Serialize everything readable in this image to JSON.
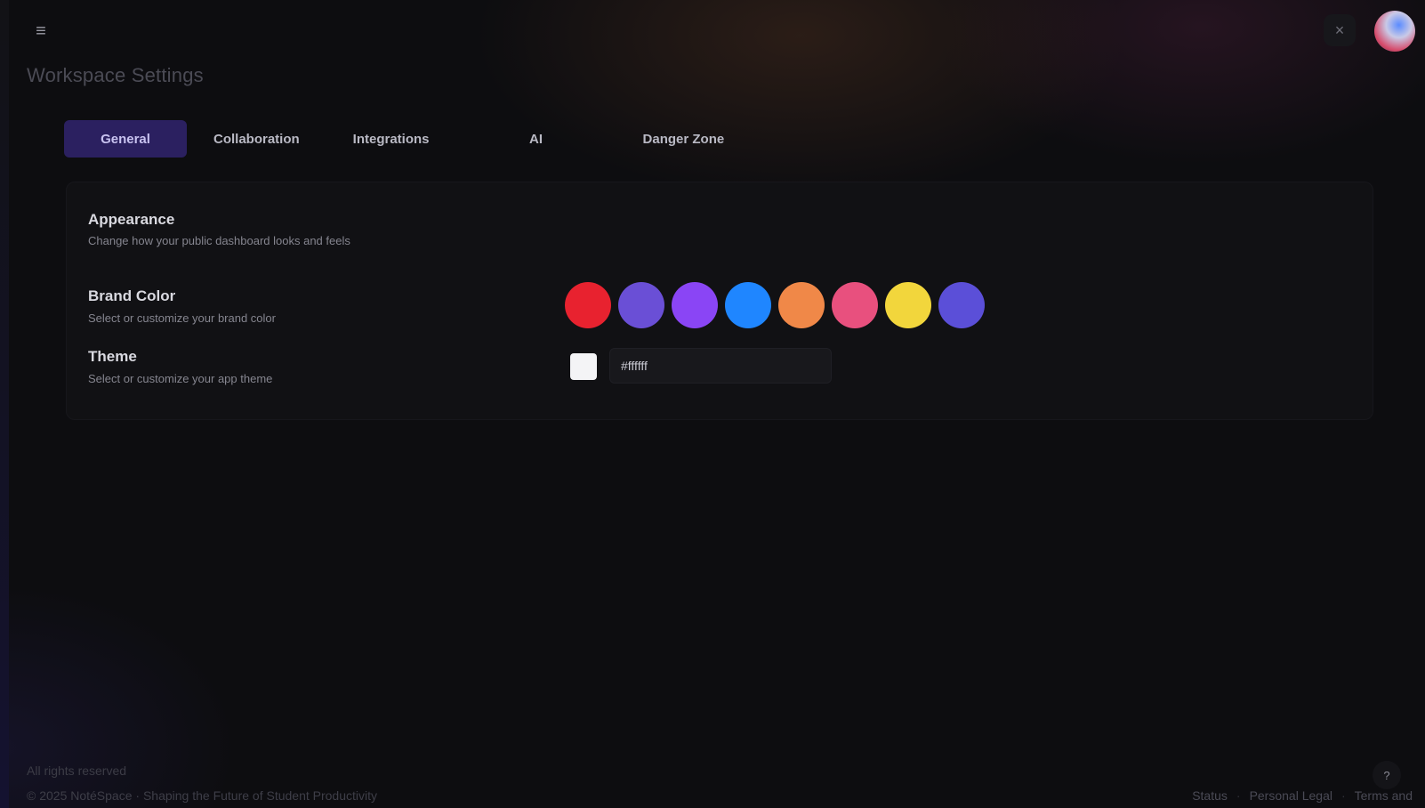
{
  "header": {
    "menu_icon": "≡",
    "close_icon": "×",
    "avatar_alt": "avatar"
  },
  "page": {
    "title": "Workspace Settings"
  },
  "tabs": [
    {
      "label": "General",
      "active": true
    },
    {
      "label": "Collaboration",
      "active": false
    },
    {
      "label": "Integrations",
      "active": false
    },
    {
      "label": "AI",
      "active": false
    },
    {
      "label": "Danger Zone",
      "active": false
    }
  ],
  "appearance": {
    "title": "Appearance",
    "description": "Change how your public dashboard looks and feels",
    "brand_color": {
      "label": "Brand Color",
      "description": "Select or customize your brand color",
      "swatches": [
        "#e8222f",
        "#6a4fd6",
        "#8a45f5",
        "#1f86ff",
        "#f08848",
        "#e8507e",
        "#f2d63c",
        "#5b4fd8"
      ]
    },
    "theme": {
      "label": "Theme",
      "description": "Select or customize your app theme",
      "swatch": "#f4f4f6",
      "value": "#ffffff"
    }
  },
  "footer": {
    "rights": "All rights reserved",
    "copyright": "© 2025 NotéSpace · Shaping the Future of Student Productivity",
    "links": [
      "Status",
      "Personal Legal",
      "Terms and"
    ],
    "help_icon": "?"
  }
}
